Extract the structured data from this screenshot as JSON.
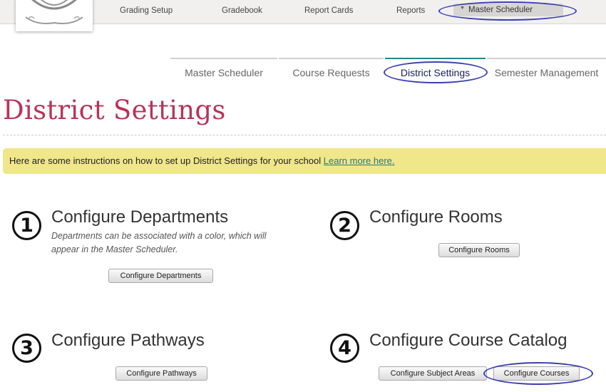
{
  "topnav": {
    "items": [
      "Grading Setup",
      "Gradebook",
      "Report Cards",
      "Reports"
    ],
    "active": "Master Scheduler"
  },
  "tabs": [
    {
      "label": "Master Scheduler",
      "active": false
    },
    {
      "label": "Course Requests",
      "active": false
    },
    {
      "label": "District Settings",
      "active": true
    },
    {
      "label": "Semester Management",
      "active": false
    }
  ],
  "page": {
    "title": "District Settings",
    "banner_text": "Here are some instructions on how to set up District Settings for your school",
    "banner_link": "Learn more here."
  },
  "steps": [
    {
      "number": "1",
      "title": "Configure Departments",
      "description": "Departments can be associated with a color, which will appear in the Master Scheduler.",
      "buttons": [
        "Configure Departments"
      ]
    },
    {
      "number": "2",
      "title": "Configure Rooms",
      "buttons": [
        "Configure Rooms"
      ]
    },
    {
      "number": "3",
      "title": "Configure Pathways",
      "buttons": [
        "Configure Pathways"
      ]
    },
    {
      "number": "4",
      "title": "Configure Course Catalog",
      "buttons": [
        "Configure Subject Areas",
        "Configure Courses"
      ]
    }
  ],
  "colors": {
    "title": "#b8335b",
    "banner": "#f0e68a",
    "active_tab": "#1a8a8a",
    "annotation": "#3b3fb5"
  }
}
